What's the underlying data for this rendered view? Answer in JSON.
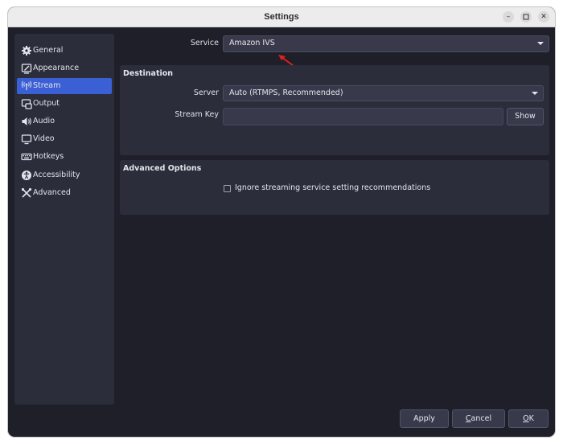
{
  "window": {
    "title": "Settings"
  },
  "sidebar": {
    "items": [
      {
        "label": "General",
        "icon": "gear-icon",
        "active": false
      },
      {
        "label": "Appearance",
        "icon": "appearance-icon",
        "active": false
      },
      {
        "label": "Stream",
        "icon": "antenna-icon",
        "active": true
      },
      {
        "label": "Output",
        "icon": "output-icon",
        "active": false
      },
      {
        "label": "Audio",
        "icon": "speaker-icon",
        "active": false
      },
      {
        "label": "Video",
        "icon": "monitor-icon",
        "active": false
      },
      {
        "label": "Hotkeys",
        "icon": "keyboard-icon",
        "active": false
      },
      {
        "label": "Accessibility",
        "icon": "accessibility-icon",
        "active": false
      },
      {
        "label": "Advanced",
        "icon": "tools-icon",
        "active": false
      }
    ]
  },
  "service": {
    "label": "Service",
    "value": "Amazon IVS"
  },
  "destination": {
    "title": "Destination",
    "server_label": "Server",
    "server_value": "Auto (RTMPS, Recommended)",
    "stream_key_label": "Stream Key",
    "stream_key_value": "",
    "show_label": "Show"
  },
  "advanced": {
    "title": "Advanced Options",
    "ignore_label": "Ignore streaming service setting recommendations",
    "ignore_checked": false
  },
  "footer": {
    "apply_label": "Apply",
    "cancel_prefix": "",
    "cancel_mnemonic": "C",
    "cancel_rest": "ancel",
    "ok_mnemonic": "O",
    "ok_rest": "K"
  },
  "colors": {
    "accent": "#3b5fd4",
    "annotation_arrow": "#e0201c"
  }
}
